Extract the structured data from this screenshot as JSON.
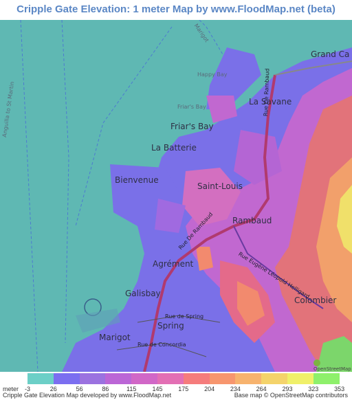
{
  "title": "Cripple Gate Elevation: 1 meter Map by www.FloodMap.net (beta)",
  "map": {
    "places": [
      {
        "id": "place-grand-case",
        "label": "Grand Ca"
      },
      {
        "id": "place-la-savane",
        "label": "La Savane"
      },
      {
        "id": "place-friars-bay",
        "label": "Friar's Bay"
      },
      {
        "id": "place-la-batterie",
        "label": "La Batterie"
      },
      {
        "id": "place-bienvenue",
        "label": "Bienvenue"
      },
      {
        "id": "place-saint-louis",
        "label": "Saint-Louis"
      },
      {
        "id": "place-rambaud",
        "label": "Rambaud"
      },
      {
        "id": "place-agrement",
        "label": "Agrément"
      },
      {
        "id": "place-galisbay",
        "label": "Galisbay"
      },
      {
        "id": "place-colombier",
        "label": "Colombier"
      },
      {
        "id": "place-spring",
        "label": "Spring"
      },
      {
        "id": "place-marigot",
        "label": "Marigot"
      },
      {
        "id": "place-happy-bay",
        "label": "Happy Bay"
      },
      {
        "id": "place-friars-bay-small",
        "label": "Friar's Bay"
      },
      {
        "id": "place-anguilla",
        "label": "Anguilla to St Martin"
      },
      {
        "id": "place-marigot-top",
        "label": "Marigot"
      }
    ],
    "streets": [
      {
        "id": "street-rue-de-rambaud-1",
        "label": "Rue De Rambaud"
      },
      {
        "id": "street-rue-de-rambaud-2",
        "label": "Rue De Rambaud"
      },
      {
        "id": "street-rue-eugene",
        "label": "Rue Eugène Léopold Helligard"
      },
      {
        "id": "street-rue-de-spring",
        "label": "Rue de Spring"
      },
      {
        "id": "street-rue-de-concordia",
        "label": "Rue de Concordia"
      }
    ],
    "osm_badge": "OpenStreetMap"
  },
  "legend": {
    "unit": "meter",
    "ticks": [
      "-3",
      "26",
      "56",
      "86",
      "115",
      "145",
      "175",
      "204",
      "234",
      "264",
      "293",
      "323",
      "353"
    ],
    "colors": [
      "#6ccfc7",
      "#7b6ef0",
      "#9b72e0",
      "#bb66d6",
      "#d167c7",
      "#e36fb4",
      "#f57c7c",
      "#f7966e",
      "#f7b36e",
      "#f4d36b",
      "#f0f06a",
      "#8ef06b",
      "#6fe06b"
    ]
  },
  "footer": {
    "left": "Cripple Gate Elevation Map developed by www.FloodMap.net",
    "right": "Base map © OpenStreetMap contributors"
  }
}
